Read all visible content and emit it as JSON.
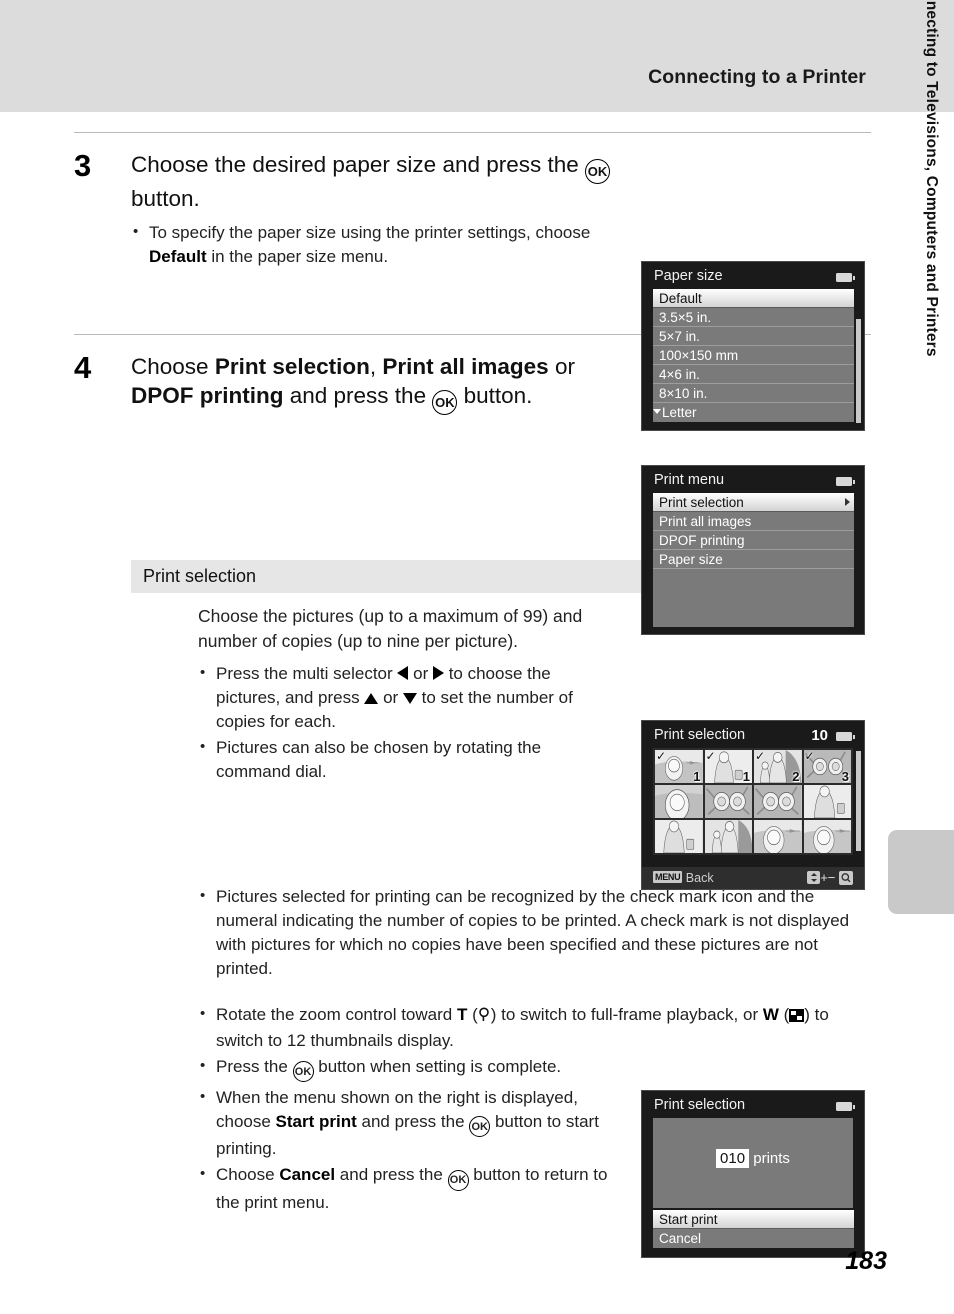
{
  "header": {
    "title": "Connecting to a Printer"
  },
  "side_tab": {
    "label": "Connecting to Televisions, Computers and Printers"
  },
  "page": {
    "number": "183"
  },
  "steps": [
    {
      "number": "3",
      "title_pre": "Choose the desired paper size and press the ",
      "title_post": " button.",
      "ok_glyph": "OK",
      "bullets": [
        {
          "pre": "To specify the paper size using the printer settings, choose ",
          "bold": "Default",
          "post": " in the paper size menu."
        }
      ]
    },
    {
      "number": "4",
      "t1": "Choose ",
      "b1": "Print selection",
      "t2": ", ",
      "b2": "Print all images",
      "t3": " or ",
      "b3": "DPOF printing",
      "t4": " and press the ",
      "t5": " button.",
      "ok_glyph": "OK"
    }
  ],
  "section": {
    "title": "Print selection"
  },
  "description": {
    "intro": "Choose the pictures (up to a maximum of 99) and number of copies (up to nine per picture).",
    "b1_pre": "Press the multi selector ",
    "b1_mid": " or ",
    "b1_mid2": " to choose the pictures, and press ",
    "b1_mid3": " or ",
    "b1_post": " to set the number of copies for each.",
    "b2": "Pictures can also be chosen by rotating the command dial.",
    "b3": "Pictures selected for printing can be recognized by the check mark icon and the numeral indicating the number of copies to be printed. A check mark is not displayed with pictures for which no copies have been specified and these pictures are not printed.",
    "b4_pre": "Rotate the zoom control toward ",
    "b4_t": "T",
    "b4_mid": ") to switch to full-frame playback, or ",
    "b4_w": "W",
    "b4_post": ") to switch to 12 thumbnails display.",
    "b5_pre": "Press the ",
    "b5_post": " button when setting is complete.",
    "b6_pre": "When the menu shown on the right is displayed, choose ",
    "b6_bold": "Start print",
    "b6_mid": " and press the ",
    "b6_post": " button to start printing.",
    "b7_pre": "Choose ",
    "b7_bold": "Cancel",
    "b7_mid": " and press the ",
    "b7_post": " button to return to the print menu."
  },
  "screens": {
    "paper_size": {
      "title": "Paper size",
      "battery_icon": "battery-icon",
      "items": [
        {
          "label": "Default",
          "selected": true
        },
        {
          "label": "3.5×5 in.",
          "selected": false
        },
        {
          "label": "5×7 in.",
          "selected": false
        },
        {
          "label": "100×150 mm",
          "selected": false
        },
        {
          "label": "4×6 in.",
          "selected": false
        },
        {
          "label": "8×10 in.",
          "selected": false
        },
        {
          "label": "Letter",
          "selected": false,
          "more": true
        }
      ]
    },
    "print_menu": {
      "title": "Print menu",
      "battery_icon": "battery-icon",
      "items": [
        {
          "label": "Print selection",
          "selected": true,
          "submenu": true
        },
        {
          "label": "Print all images",
          "selected": false
        },
        {
          "label": "DPOF printing",
          "selected": false
        },
        {
          "label": "Paper size",
          "selected": false
        }
      ]
    },
    "print_selection_thumbs": {
      "title": "Print selection",
      "count": "10",
      "battery_icon": "battery-icon",
      "thumbnails": [
        {
          "art": "woman-beach",
          "checked": true,
          "copies": "1"
        },
        {
          "art": "woman-bag",
          "checked": true,
          "copies": "1"
        },
        {
          "art": "mother-child",
          "checked": true,
          "copies": "2"
        },
        {
          "art": "flowers",
          "checked": true,
          "copies": "3"
        },
        {
          "art": "portrait",
          "checked": false,
          "copies": ""
        },
        {
          "art": "flowers",
          "checked": false,
          "copies": ""
        },
        {
          "art": "flowers",
          "checked": false,
          "copies": ""
        },
        {
          "art": "woman-bag",
          "checked": false,
          "copies": ""
        },
        {
          "art": "woman-bag",
          "checked": false,
          "copies": ""
        },
        {
          "art": "mother-child",
          "checked": false,
          "copies": ""
        },
        {
          "art": "woman-beach",
          "checked": false,
          "copies": ""
        },
        {
          "art": "woman-beach",
          "checked": false,
          "copies": ""
        }
      ],
      "footer": {
        "menu_chip": "MENU",
        "back_label": "Back",
        "updown_icon": "up-down-arrows-icon",
        "plus": "+",
        "minus": "−",
        "zoom_icon": "magnifier-icon"
      }
    },
    "start_print": {
      "title": "Print selection",
      "battery_icon": "battery-icon",
      "count_value": "010",
      "count_label": "prints",
      "items": [
        {
          "label": "Start print",
          "selected": true
        },
        {
          "label": "Cancel",
          "selected": false
        }
      ]
    }
  }
}
